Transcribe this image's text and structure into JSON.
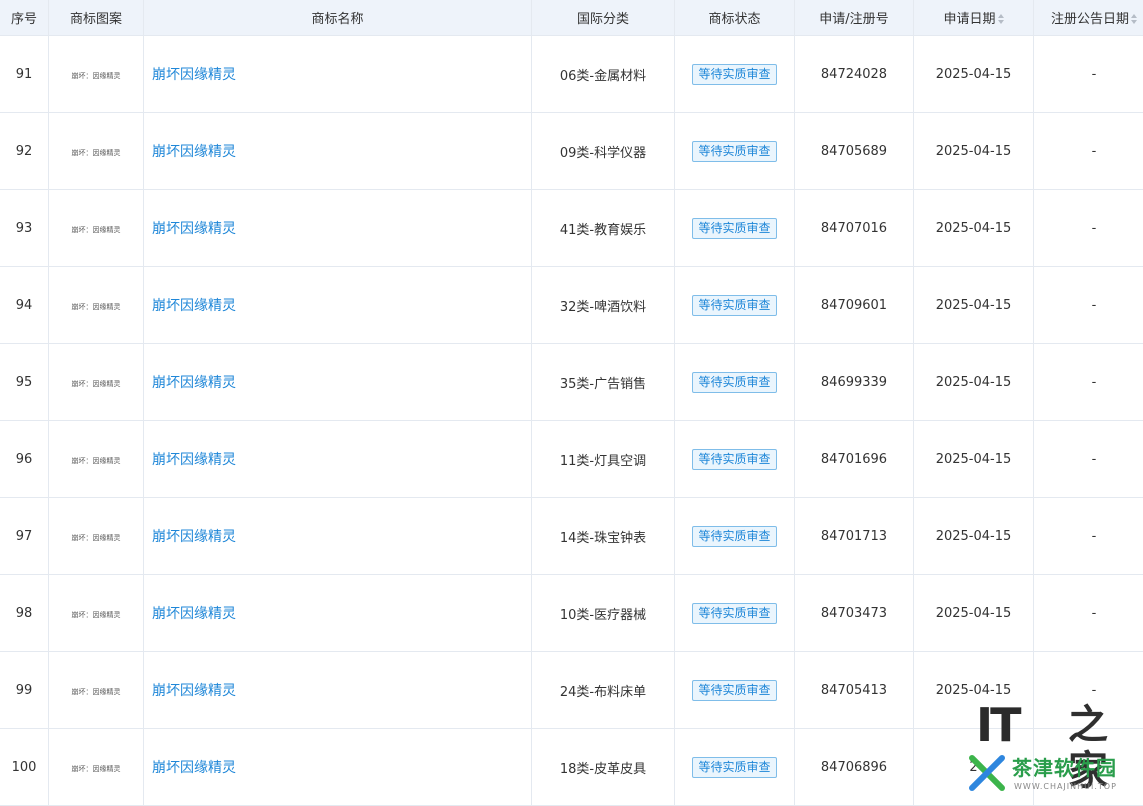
{
  "table": {
    "headers": [
      "序号",
      "商标图案",
      "商标名称",
      "国际分类",
      "商标状态",
      "申请/注册号",
      "申请日期",
      "注册公告日期"
    ],
    "rows": [
      {
        "index": "91",
        "pattern": "崩坏：因缘精灵",
        "name": "崩坏因缘精灵",
        "class": "06类-金属材料",
        "status": "等待实质审查",
        "reg_no": "84724028",
        "apply_date": "2025-04-15",
        "announce_date": "-"
      },
      {
        "index": "92",
        "pattern": "崩坏：因缘精灵",
        "name": "崩坏因缘精灵",
        "class": "09类-科学仪器",
        "status": "等待实质审查",
        "reg_no": "84705689",
        "apply_date": "2025-04-15",
        "announce_date": "-"
      },
      {
        "index": "93",
        "pattern": "崩坏：因缘精灵",
        "name": "崩坏因缘精灵",
        "class": "41类-教育娱乐",
        "status": "等待实质审查",
        "reg_no": "84707016",
        "apply_date": "2025-04-15",
        "announce_date": "-"
      },
      {
        "index": "94",
        "pattern": "崩坏：因缘精灵",
        "name": "崩坏因缘精灵",
        "class": "32类-啤酒饮料",
        "status": "等待实质审查",
        "reg_no": "84709601",
        "apply_date": "2025-04-15",
        "announce_date": "-"
      },
      {
        "index": "95",
        "pattern": "崩坏：因缘精灵",
        "name": "崩坏因缘精灵",
        "class": "35类-广告销售",
        "status": "等待实质审查",
        "reg_no": "84699339",
        "apply_date": "2025-04-15",
        "announce_date": "-"
      },
      {
        "index": "96",
        "pattern": "崩坏：因缘精灵",
        "name": "崩坏因缘精灵",
        "class": "11类-灯具空调",
        "status": "等待实质审查",
        "reg_no": "84701696",
        "apply_date": "2025-04-15",
        "announce_date": "-"
      },
      {
        "index": "97",
        "pattern": "崩坏：因缘精灵",
        "name": "崩坏因缘精灵",
        "class": "14类-珠宝钟表",
        "status": "等待实质审查",
        "reg_no": "84701713",
        "apply_date": "2025-04-15",
        "announce_date": "-"
      },
      {
        "index": "98",
        "pattern": "崩坏：因缘精灵",
        "name": "崩坏因缘精灵",
        "class": "10类-医疗器械",
        "status": "等待实质审查",
        "reg_no": "84703473",
        "apply_date": "2025-04-15",
        "announce_date": "-"
      },
      {
        "index": "99",
        "pattern": "崩坏：因缘精灵",
        "name": "崩坏因缘精灵",
        "class": "24类-布料床单",
        "status": "等待实质审查",
        "reg_no": "84705413",
        "apply_date": "2025-04-15",
        "announce_date": "-"
      },
      {
        "index": "100",
        "pattern": "崩坏：因缘精灵",
        "name": "崩坏因缘精灵",
        "class": "18类-皮革皮具",
        "status": "等待实质审查",
        "reg_no": "84706896",
        "apply_date": "2",
        "announce_date": ""
      }
    ]
  },
  "watermark": {
    "logo_text": "IT",
    "logo_char": "之家",
    "site_name": "茶津软件园",
    "site_url": "WWW.CHAJINHUI.TOP"
  },
  "colors": {
    "header_bg": "#eef3fa",
    "border": "#e4e9f0",
    "link": "#1f87d8",
    "badge_bg": "#eaf5fd",
    "badge_border": "#7fbde9"
  }
}
